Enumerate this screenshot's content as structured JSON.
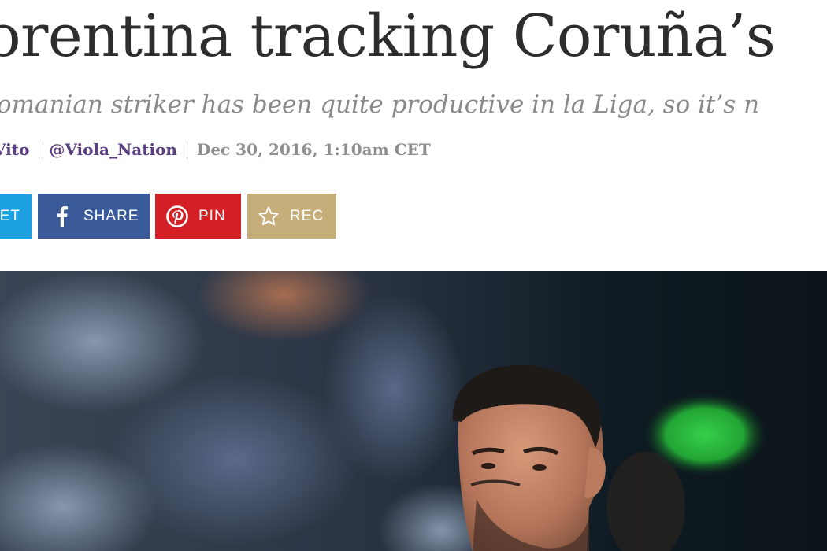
{
  "article": {
    "headline": "orentina tracking Coruña’s",
    "dek": "omanian striker has been quite productive in la Liga, so it’s n",
    "author": "Vito",
    "twitter_handle": "@Viola_Nation",
    "date": "Dec 30, 2016, 1:10am CET"
  },
  "share": {
    "tweet_label": "ET",
    "facebook_label": "SHARE",
    "pinterest_label": "PIN",
    "recommend_label": "REC"
  },
  "icons": {
    "facebook": "facebook-icon",
    "pinterest": "pinterest-icon",
    "recommend": "star-icon"
  },
  "colors": {
    "twitter": "#1da1e2",
    "facebook": "#3a5a9a",
    "pinterest": "#d41f26",
    "recommend": "#c6ae7b",
    "byline_link": "#5a3d82",
    "headline": "#2d2d2d",
    "dek": "#8a8a8a"
  }
}
